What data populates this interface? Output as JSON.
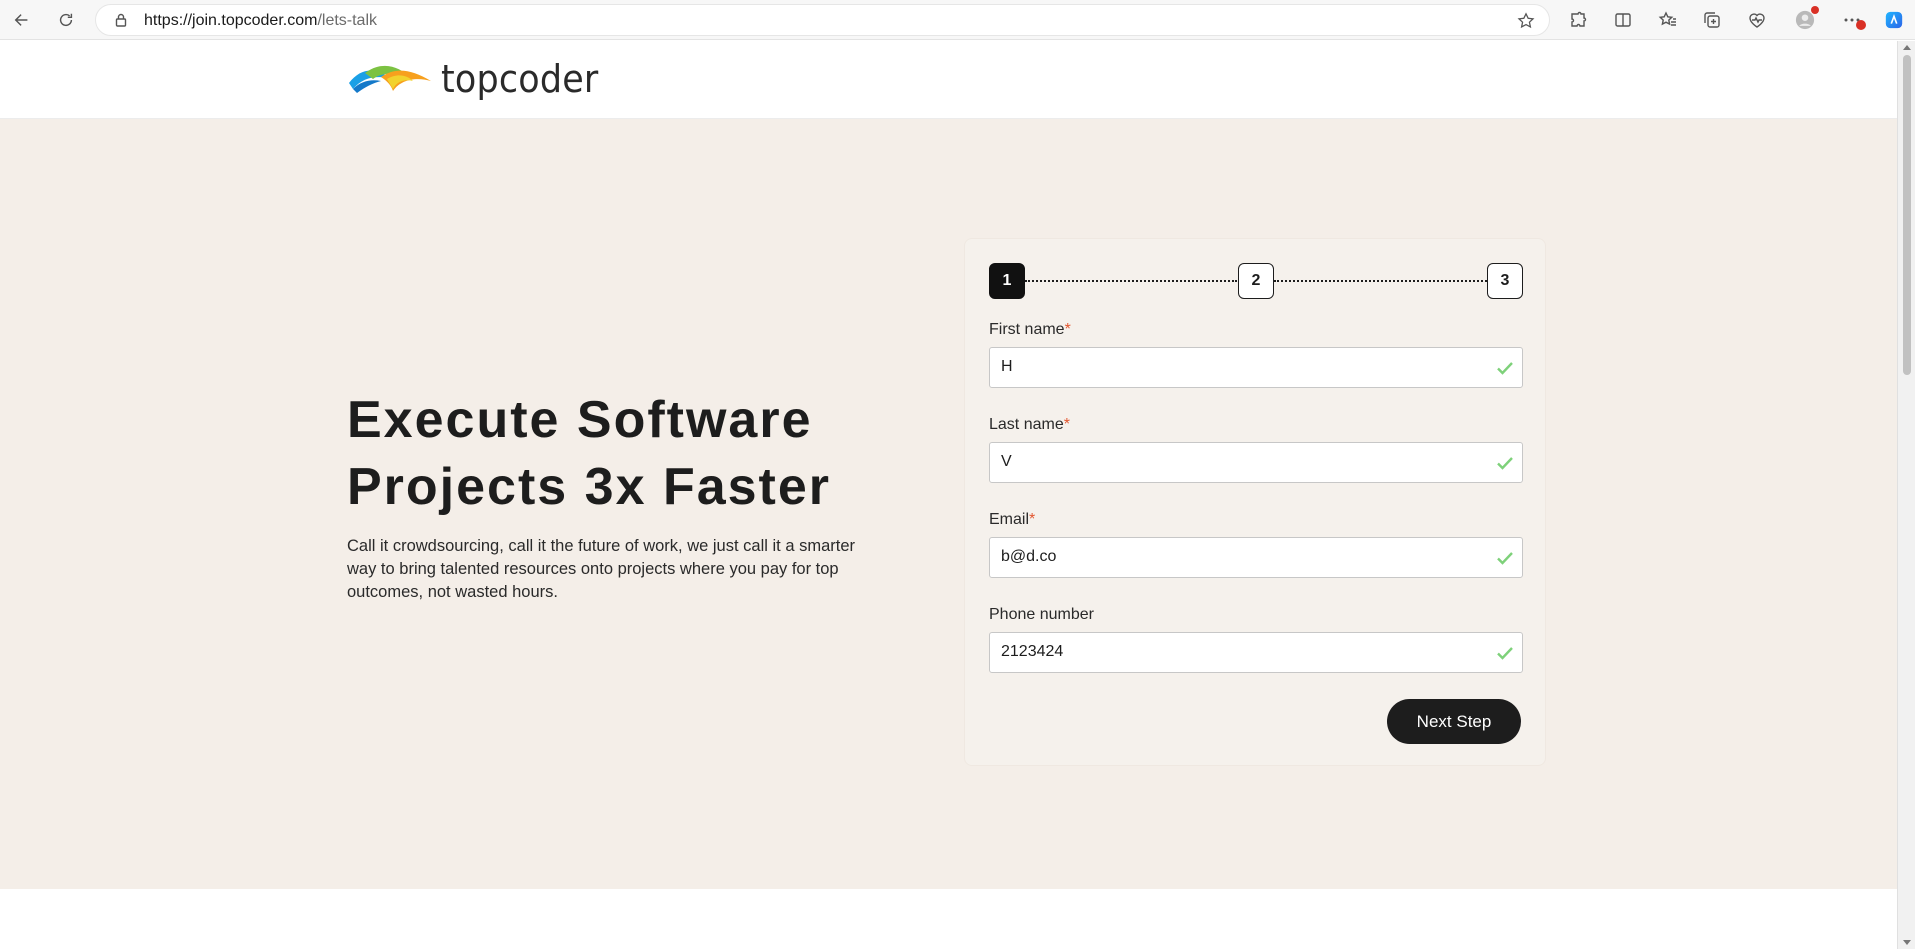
{
  "browser": {
    "url_host": "https://join.topcoder.com",
    "url_path": "/lets-talk"
  },
  "header": {
    "logo_text": "topcoder"
  },
  "hero": {
    "headline_line1": "Execute Software",
    "headline_line2": "Projects 3x Faster",
    "description": "Call it crowdsourcing, call it the future of work, we just call it a smarter way to bring talented resources onto projects where you pay for top outcomes, not wasted hours."
  },
  "form": {
    "steps": [
      "1",
      "2",
      "3"
    ],
    "active_step": "1",
    "fields": {
      "first_name": {
        "label": "First name",
        "required_mark": "*",
        "value": "H",
        "valid": true
      },
      "last_name": {
        "label": "Last name",
        "required_mark": "*",
        "value": "V",
        "valid": true
      },
      "email": {
        "label": "Email",
        "required_mark": "*",
        "value": "b@d.co",
        "valid": true
      },
      "phone": {
        "label": "Phone number",
        "value": "2123424",
        "valid": true
      }
    },
    "next_button_label": "Next Step"
  },
  "colors": {
    "hero_background": "#f4eee8",
    "card_background": "#f5f1ec",
    "button_dark": "#1d1d1d",
    "required_asterisk": "#e2562f",
    "valid_check": "#7ed17a"
  },
  "icons": {
    "toolbar": [
      "back-icon",
      "reload-icon",
      "lock-icon",
      "star-icon",
      "extensions-icon",
      "split-screen-icon",
      "favorites-icon",
      "collections-icon",
      "browser-essentials-icon",
      "profile-icon",
      "more-icon",
      "copilot-icon"
    ]
  }
}
